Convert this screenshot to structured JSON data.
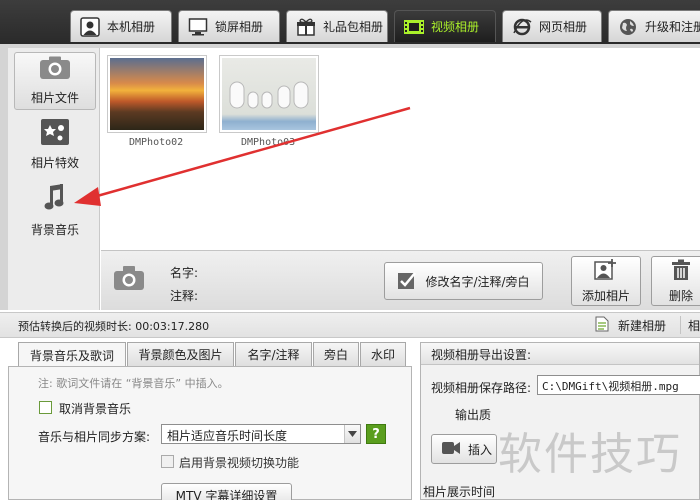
{
  "top_tabs": [
    {
      "label": "本机相册",
      "icon": "portrait-icon"
    },
    {
      "label": "锁屏相册",
      "icon": "monitor-icon"
    },
    {
      "label": "礼品包相册",
      "icon": "gift-icon"
    },
    {
      "label": "视频相册",
      "icon": "film-icon",
      "active": true
    },
    {
      "label": "网页相册",
      "icon": "ie-browser-icon"
    },
    {
      "label": "升级和注册",
      "icon": "globe-icon"
    }
  ],
  "sidebar": {
    "items": [
      {
        "label": "相片文件",
        "icon": "camera-icon",
        "active": true
      },
      {
        "label": "相片特效",
        "icon": "effects-icon"
      },
      {
        "label": "背景音乐",
        "icon": "music-note-icon"
      }
    ]
  },
  "photos": [
    {
      "name": "DMPhoto02"
    },
    {
      "name": "DMPhoto03"
    }
  ],
  "info": {
    "name_label": "名字:",
    "note_label": "注释:",
    "edit_button": "修改名字/注释/旁白",
    "add_photo": "添加相片",
    "delete": "删除"
  },
  "status": {
    "duration_text": "预估转换后的视频时长: 00:03:17.280",
    "new_album": "新建相册",
    "extra": "相"
  },
  "lower_tabs": [
    "背景音乐及歌词",
    "背景颜色及图片",
    "名字/注释",
    "旁白",
    "水印"
  ],
  "music_panel": {
    "note": "注: 歌词文件请在 “背景音乐” 中插入。",
    "cancel_bg_music": "取消背景音乐",
    "sync_label": "音乐与相片同步方案:",
    "sync_value": "相片适应音乐时间长度",
    "help": "?",
    "bg_video_switch": "启用背景视频切换功能",
    "mtv_button": "MTV 字幕详细设置"
  },
  "export": {
    "title": "视频相册导出设置:",
    "save_path_label": "视频相册保存路径:",
    "save_path_value": "C:\\DMGift\\视频相册.mpg",
    "output_quality_label": "输出质",
    "insert_button": "插入",
    "photo_display_label": "相片展示时间"
  },
  "watermark": "软件技巧",
  "colors": {
    "active_tab_text": "#aaf02a",
    "annotation_arrow": "#e03030",
    "help_green": "#5a9e1e"
  }
}
